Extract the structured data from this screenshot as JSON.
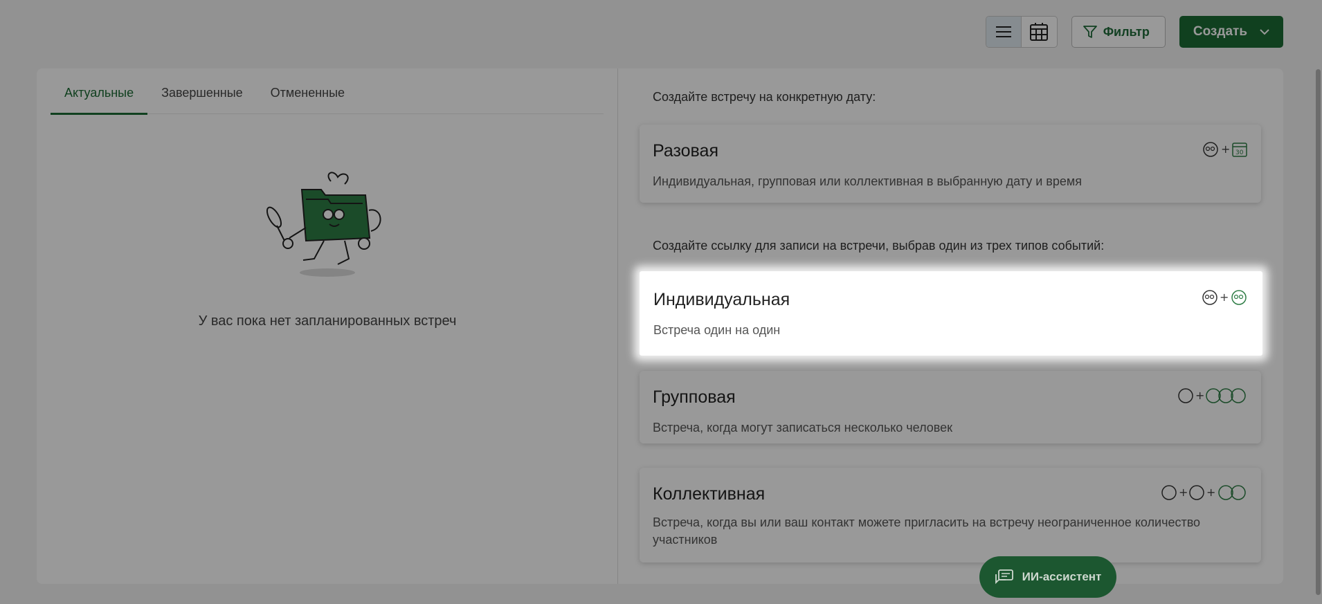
{
  "toolbar": {
    "list_view_icon": "list-icon",
    "calendar_view_icon": "grid-calendar-icon",
    "filter_label": "Фильтр",
    "filter_icon": "funnel-icon",
    "create_label": "Создать",
    "create_icon": "chevron-down-icon"
  },
  "tabs": [
    {
      "label": "Актуальные",
      "active": true
    },
    {
      "label": "Завершенные",
      "active": false
    },
    {
      "label": "Отмененные",
      "active": false
    }
  ],
  "empty_state": {
    "text": "У вас пока нет запланированных встреч"
  },
  "right": {
    "date_section_title": "Создайте встречу на конкретную дату:",
    "link_section_title": "Создайте ссылку для записи на встречи, выбрав один из трех типов событий:",
    "cards": [
      {
        "title": "Разовая",
        "desc": "Индивидуальная, групповая или коллективная в выбранную дату и время"
      },
      {
        "title": "Индивидуальная",
        "desc": "Встреча один на один"
      },
      {
        "title": "Групповая",
        "desc": "Встреча, когда могут записаться несколько человек"
      },
      {
        "title": "Коллективная",
        "desc": "Встреча, когда вы или ваш контакт можете пригласить на встречу неограниченное количество участников"
      }
    ]
  },
  "assistant": {
    "label": "ИИ-ассистент",
    "icon": "chat-icon"
  },
  "colors": {
    "brand_green": "#1c6b34",
    "overlay": "rgba(0,0,0,0.4)"
  }
}
